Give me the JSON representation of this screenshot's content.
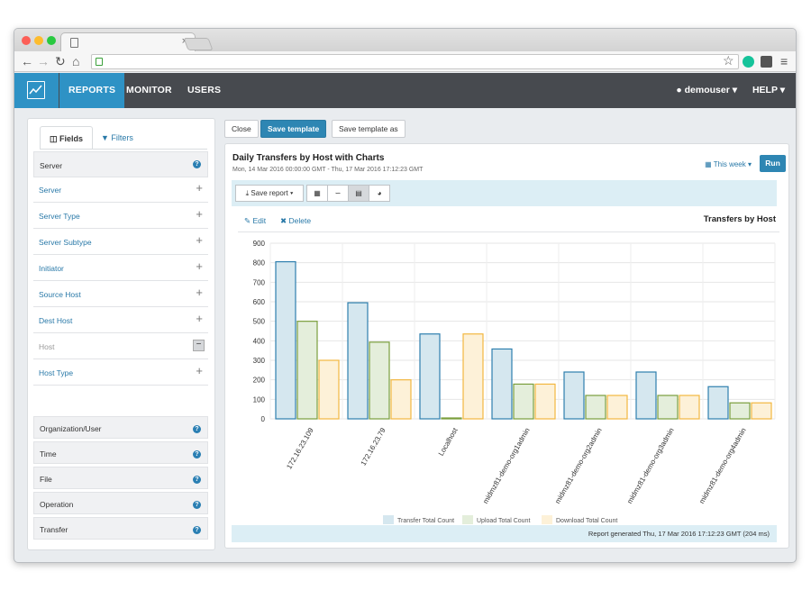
{
  "browser": {
    "tab_close": "×",
    "icons": [
      "back-icon",
      "forward-icon",
      "reload-icon",
      "home-icon",
      "lock-icon",
      "star-icon",
      "menu-icon"
    ]
  },
  "header": {
    "nav": [
      "REPORTS",
      "MONITOR",
      "USERS"
    ],
    "user": "demouser",
    "help": "HELP",
    "accent": "#2e92c5"
  },
  "sidebar": {
    "tabs": [
      "Fields",
      "Filters"
    ],
    "server_group": "Server",
    "server_fields": [
      "Server",
      "Server Type",
      "Server Subtype",
      "Initiator",
      "Source Host",
      "Dest Host",
      "Host",
      "Host Type"
    ],
    "groups": [
      "Organization/User",
      "Time",
      "File",
      "Operation",
      "Transfer"
    ]
  },
  "toolbar": {
    "close": "Close",
    "save_template": "Save template",
    "save_template_as": "Save template as"
  },
  "report": {
    "title": "Daily Transfers by Host with Charts",
    "subtitle": "Mon, 14 Mar 2016 00:00:00 GMT - Thu, 17 Mar 2016 17:12:23 GMT",
    "range": "This week",
    "run": "Run",
    "save_report": "Save report",
    "edit": "Edit",
    "delete": "Delete",
    "footer": "Report generated Thu, 17 Mar 2016 17:12:23 GMT (204 ms)"
  },
  "chart_data": {
    "type": "bar",
    "title": "Transfers by Host",
    "categories": [
      "172.16.23.109",
      "172.16.23.79",
      "Localhost",
      "midmz81-demo-org1admin",
      "midmz81-demo-org2admin",
      "midmz81-demo-org3admin",
      "midmz81-demo-org4admin"
    ],
    "series": [
      {
        "name": "Transfer Total Count",
        "values": [
          805,
          595,
          435,
          358,
          240,
          240,
          165
        ],
        "fill": "#d5e7ef",
        "stroke": "#2e7fae"
      },
      {
        "name": "Upload Total Count",
        "values": [
          500,
          393,
          0,
          178,
          120,
          120,
          82
        ],
        "fill": "#e4eedb",
        "stroke": "#7a9e3c"
      },
      {
        "name": "Download Total Count",
        "values": [
          300,
          200,
          435,
          178,
          120,
          120,
          82
        ],
        "fill": "#fdf1d8",
        "stroke": "#f2b740"
      }
    ],
    "yticks": [
      0,
      100,
      200,
      300,
      400,
      500,
      600,
      700,
      800,
      900
    ],
    "ylim": [
      0,
      900
    ],
    "grid": true,
    "legend": "bottom"
  }
}
